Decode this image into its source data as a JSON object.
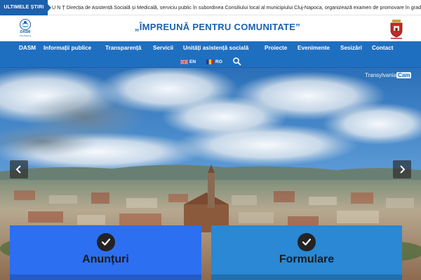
{
  "ticker": {
    "label": "ULTIMELE ȘTIRI",
    "text": "U N Ț Direcția de Asistență Socială și Medicală, serviciu public în subordinea Consiliului local al municipiului Cluj-Napoca, organizează examen de promovare în grad profesional imediat"
  },
  "header": {
    "logo_title": "DASM",
    "logo_subtitle": "Cluj-Napoca",
    "slogan": "„ÎMPREUNĂ PENTRU COMUNITATE”"
  },
  "nav": {
    "items": [
      {
        "label": "DASM"
      },
      {
        "label": "Informații publice"
      },
      {
        "label": "Transparență"
      },
      {
        "label": "Servicii"
      },
      {
        "label": "Unități asistență socială"
      },
      {
        "label": "Proiecte"
      },
      {
        "label": "Evenimente"
      },
      {
        "label": "Sesizări"
      },
      {
        "label": "Contact"
      }
    ],
    "languages": [
      {
        "code": "EN"
      },
      {
        "code": "RO"
      }
    ]
  },
  "hero": {
    "watermark_prefix": "Transylvania",
    "watermark_cam": "Cam"
  },
  "cards": [
    {
      "title": "Anunțuri",
      "color": "#2c6ff1"
    },
    {
      "title": "Formulare",
      "color": "#2a88d4"
    }
  ],
  "colors": {
    "brand_blue": "#1f6fc1",
    "accent_dark": "#232323"
  }
}
